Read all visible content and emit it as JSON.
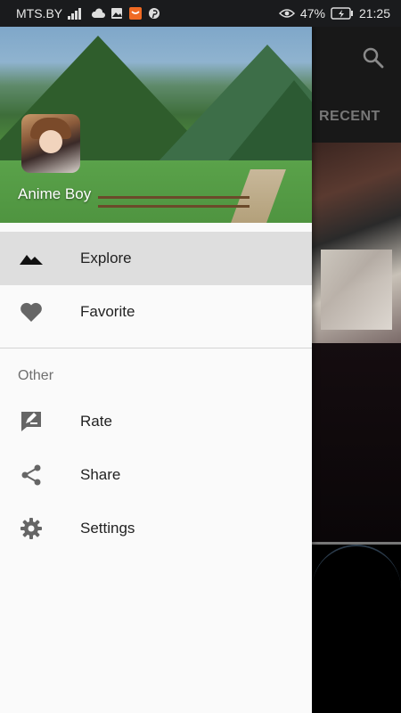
{
  "status_bar": {
    "carrier": "MTS.BY",
    "battery": "47%",
    "time": "21:25"
  },
  "background_app": {
    "tab_label": "RECENT"
  },
  "drawer": {
    "app_name": "Anime Boy",
    "main_items": [
      {
        "label": "Explore",
        "icon": "mountains-icon",
        "active": true
      },
      {
        "label": "Favorite",
        "icon": "heart-icon",
        "active": false
      }
    ],
    "section_title": "Other",
    "other_items": [
      {
        "label": "Rate",
        "icon": "rate-review-icon"
      },
      {
        "label": "Share",
        "icon": "share-icon"
      },
      {
        "label": "Settings",
        "icon": "gear-icon"
      }
    ]
  }
}
